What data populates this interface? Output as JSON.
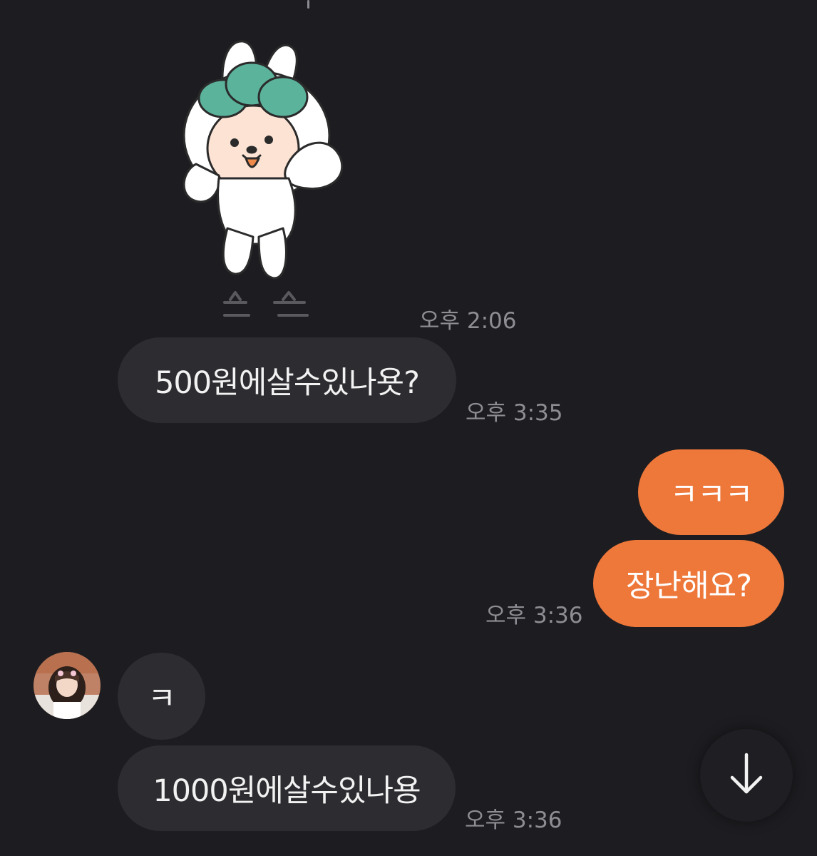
{
  "chat": {
    "sticker": {
      "icon": "bunny-sticker-icon",
      "time": "오후 2:06"
    },
    "messages": [
      {
        "text": "500원에살수있나욧?",
        "time": "오후 3:35",
        "from": "them"
      },
      {
        "text": "ㅋㅋㅋ",
        "from": "me"
      },
      {
        "text": "장난해요?",
        "time": "오후 3:36",
        "from": "me"
      },
      {
        "text": "ㅋ",
        "from": "them"
      },
      {
        "text": "1000원에살수있나용",
        "time": "오후 3:36",
        "from": "them"
      }
    ]
  },
  "scroll_button": {
    "icon": "arrow-down-icon"
  },
  "colors": {
    "background": "#1d1d21",
    "incoming_bubble": "#2c2c31",
    "outgoing_bubble": "#ee773a",
    "timestamp": "#8d8d93"
  }
}
